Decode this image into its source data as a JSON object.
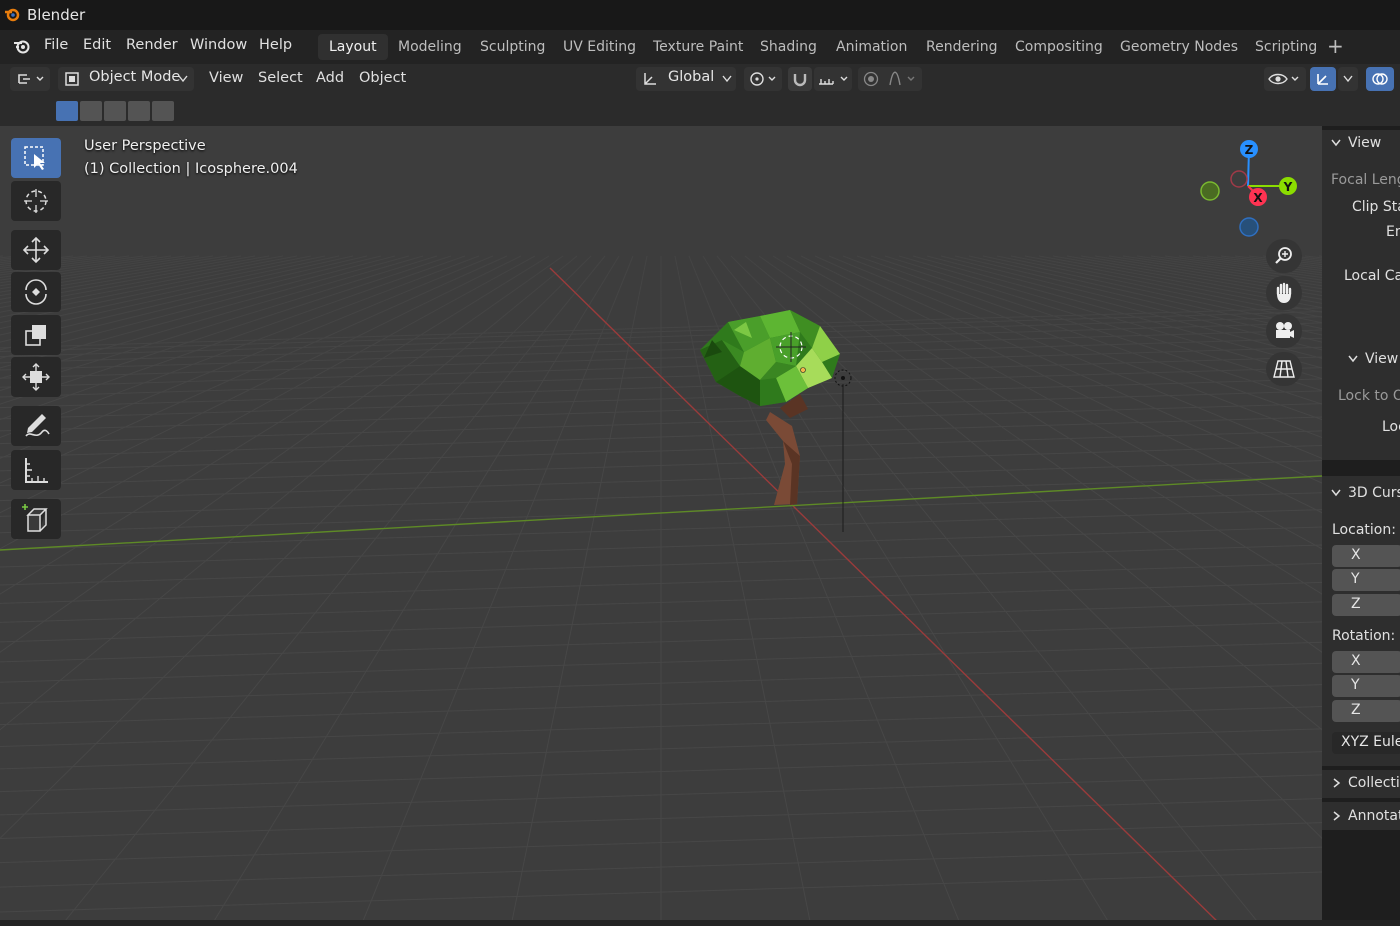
{
  "app": {
    "title": "Blender"
  },
  "menu": {
    "items": [
      "File",
      "Edit",
      "Render",
      "Window",
      "Help"
    ]
  },
  "workspaces": {
    "tabs": [
      "Layout",
      "Modeling",
      "Sculpting",
      "UV Editing",
      "Texture Paint",
      "Shading",
      "Animation",
      "Rendering",
      "Compositing",
      "Geometry Nodes",
      "Scripting"
    ],
    "active": "Layout",
    "add_label": "+"
  },
  "header": {
    "mode": "Object Mode",
    "menus": [
      "View",
      "Select",
      "Add",
      "Object"
    ],
    "orientation": "Global"
  },
  "viewport": {
    "perspective_label": "User Perspective",
    "collection_label": "(1) Collection | Icosphere.004",
    "gizmo": {
      "z": "Z",
      "y": "Y",
      "x": "X"
    }
  },
  "sidebar": {
    "view_header": "View",
    "focal_length": "Focal Lengt",
    "clip_start": "Clip Sta",
    "clip_end": "En",
    "local_camera": "Local Ca.",
    "view_lock_header": "View",
    "lock_to_object": "Lock to O.",
    "lock": "Loc",
    "cursor_header": "3D Curs",
    "location_label": "Location:",
    "location_axes": [
      "X",
      "Y",
      "Z"
    ],
    "rotation_label": "Rotation:",
    "rotation_axes": [
      "X",
      "Y",
      "Z"
    ],
    "rotation_mode": "XYZ Euler",
    "collections_header": "Collectio",
    "annotations_header": "Annotat"
  },
  "colors": {
    "accent": "#4772b3",
    "x_axis": "#ff3352",
    "y_axis": "#8bdc00",
    "z_axis": "#2890ff"
  }
}
